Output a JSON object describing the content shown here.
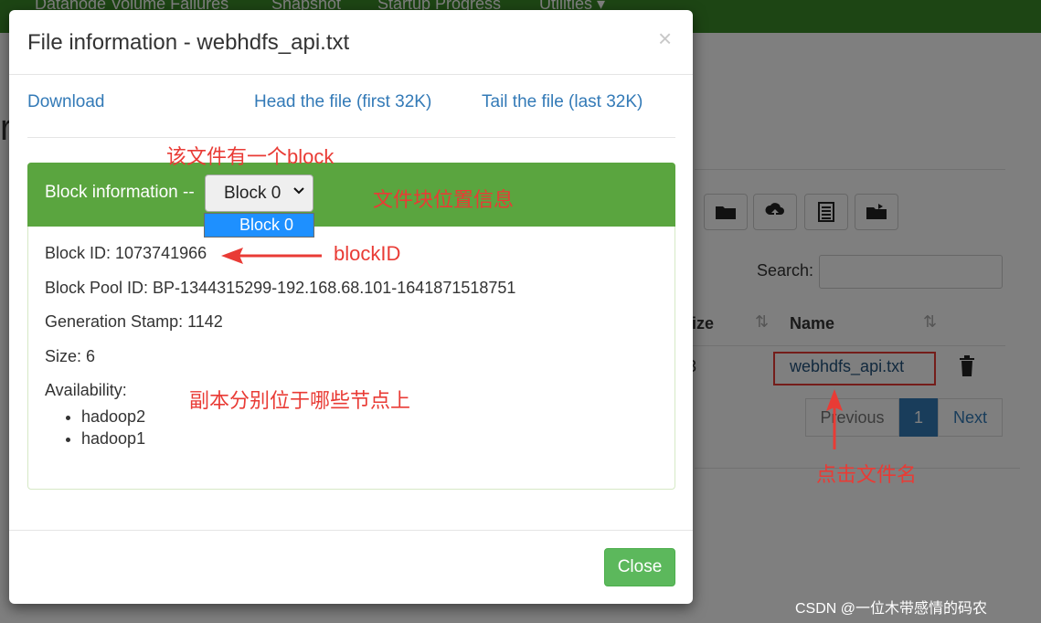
{
  "background": {
    "nav": [
      "Datanode Volume Failures",
      "Snapshot",
      "Startup Progress",
      "Utilities ▾"
    ],
    "heading_fragment": "r",
    "search_label": "Search:",
    "columns": {
      "size": "Size",
      "name": "Name"
    },
    "size_cell": "3",
    "file_name": "webhdfs_api.txt",
    "pagination": {
      "previous": "Previous",
      "current": "1",
      "next": "Next"
    }
  },
  "modal": {
    "title": "File information - webhdfs_api.txt",
    "close_glyph": "×",
    "actions": {
      "download": "Download",
      "head": "Head the file (first 32K)",
      "tail": "Tail the file (last 32K)"
    },
    "block_panel": {
      "heading": "Block information --",
      "selected_block": "Block 0",
      "dropdown_option": "Block 0"
    },
    "block_id": "Block ID: 1073741966",
    "block_pool_id": "Block Pool ID: BP-1344315299-192.168.68.101-1641871518751",
    "generation_stamp": "Generation Stamp: 1142",
    "size": "Size: 6",
    "availability_label": "Availability:",
    "nodes": [
      "hadoop2",
      "hadoop1"
    ],
    "close_button": "Close"
  },
  "annotations": {
    "one_block": "该文件有一个block",
    "block_location": "文件块位置信息",
    "block_id": "blockID",
    "replicas": "副本分别位于哪些节点上",
    "click_name": "点击文件名",
    "color": "#e93b35"
  },
  "watermark": "CSDN @一位木带感情的码农",
  "colors": {
    "navbar": "#3b8b29",
    "panel_heading": "#5aa53f",
    "link": "#337ab7",
    "primary": "#1e90ff",
    "success": "#5cb85c"
  }
}
